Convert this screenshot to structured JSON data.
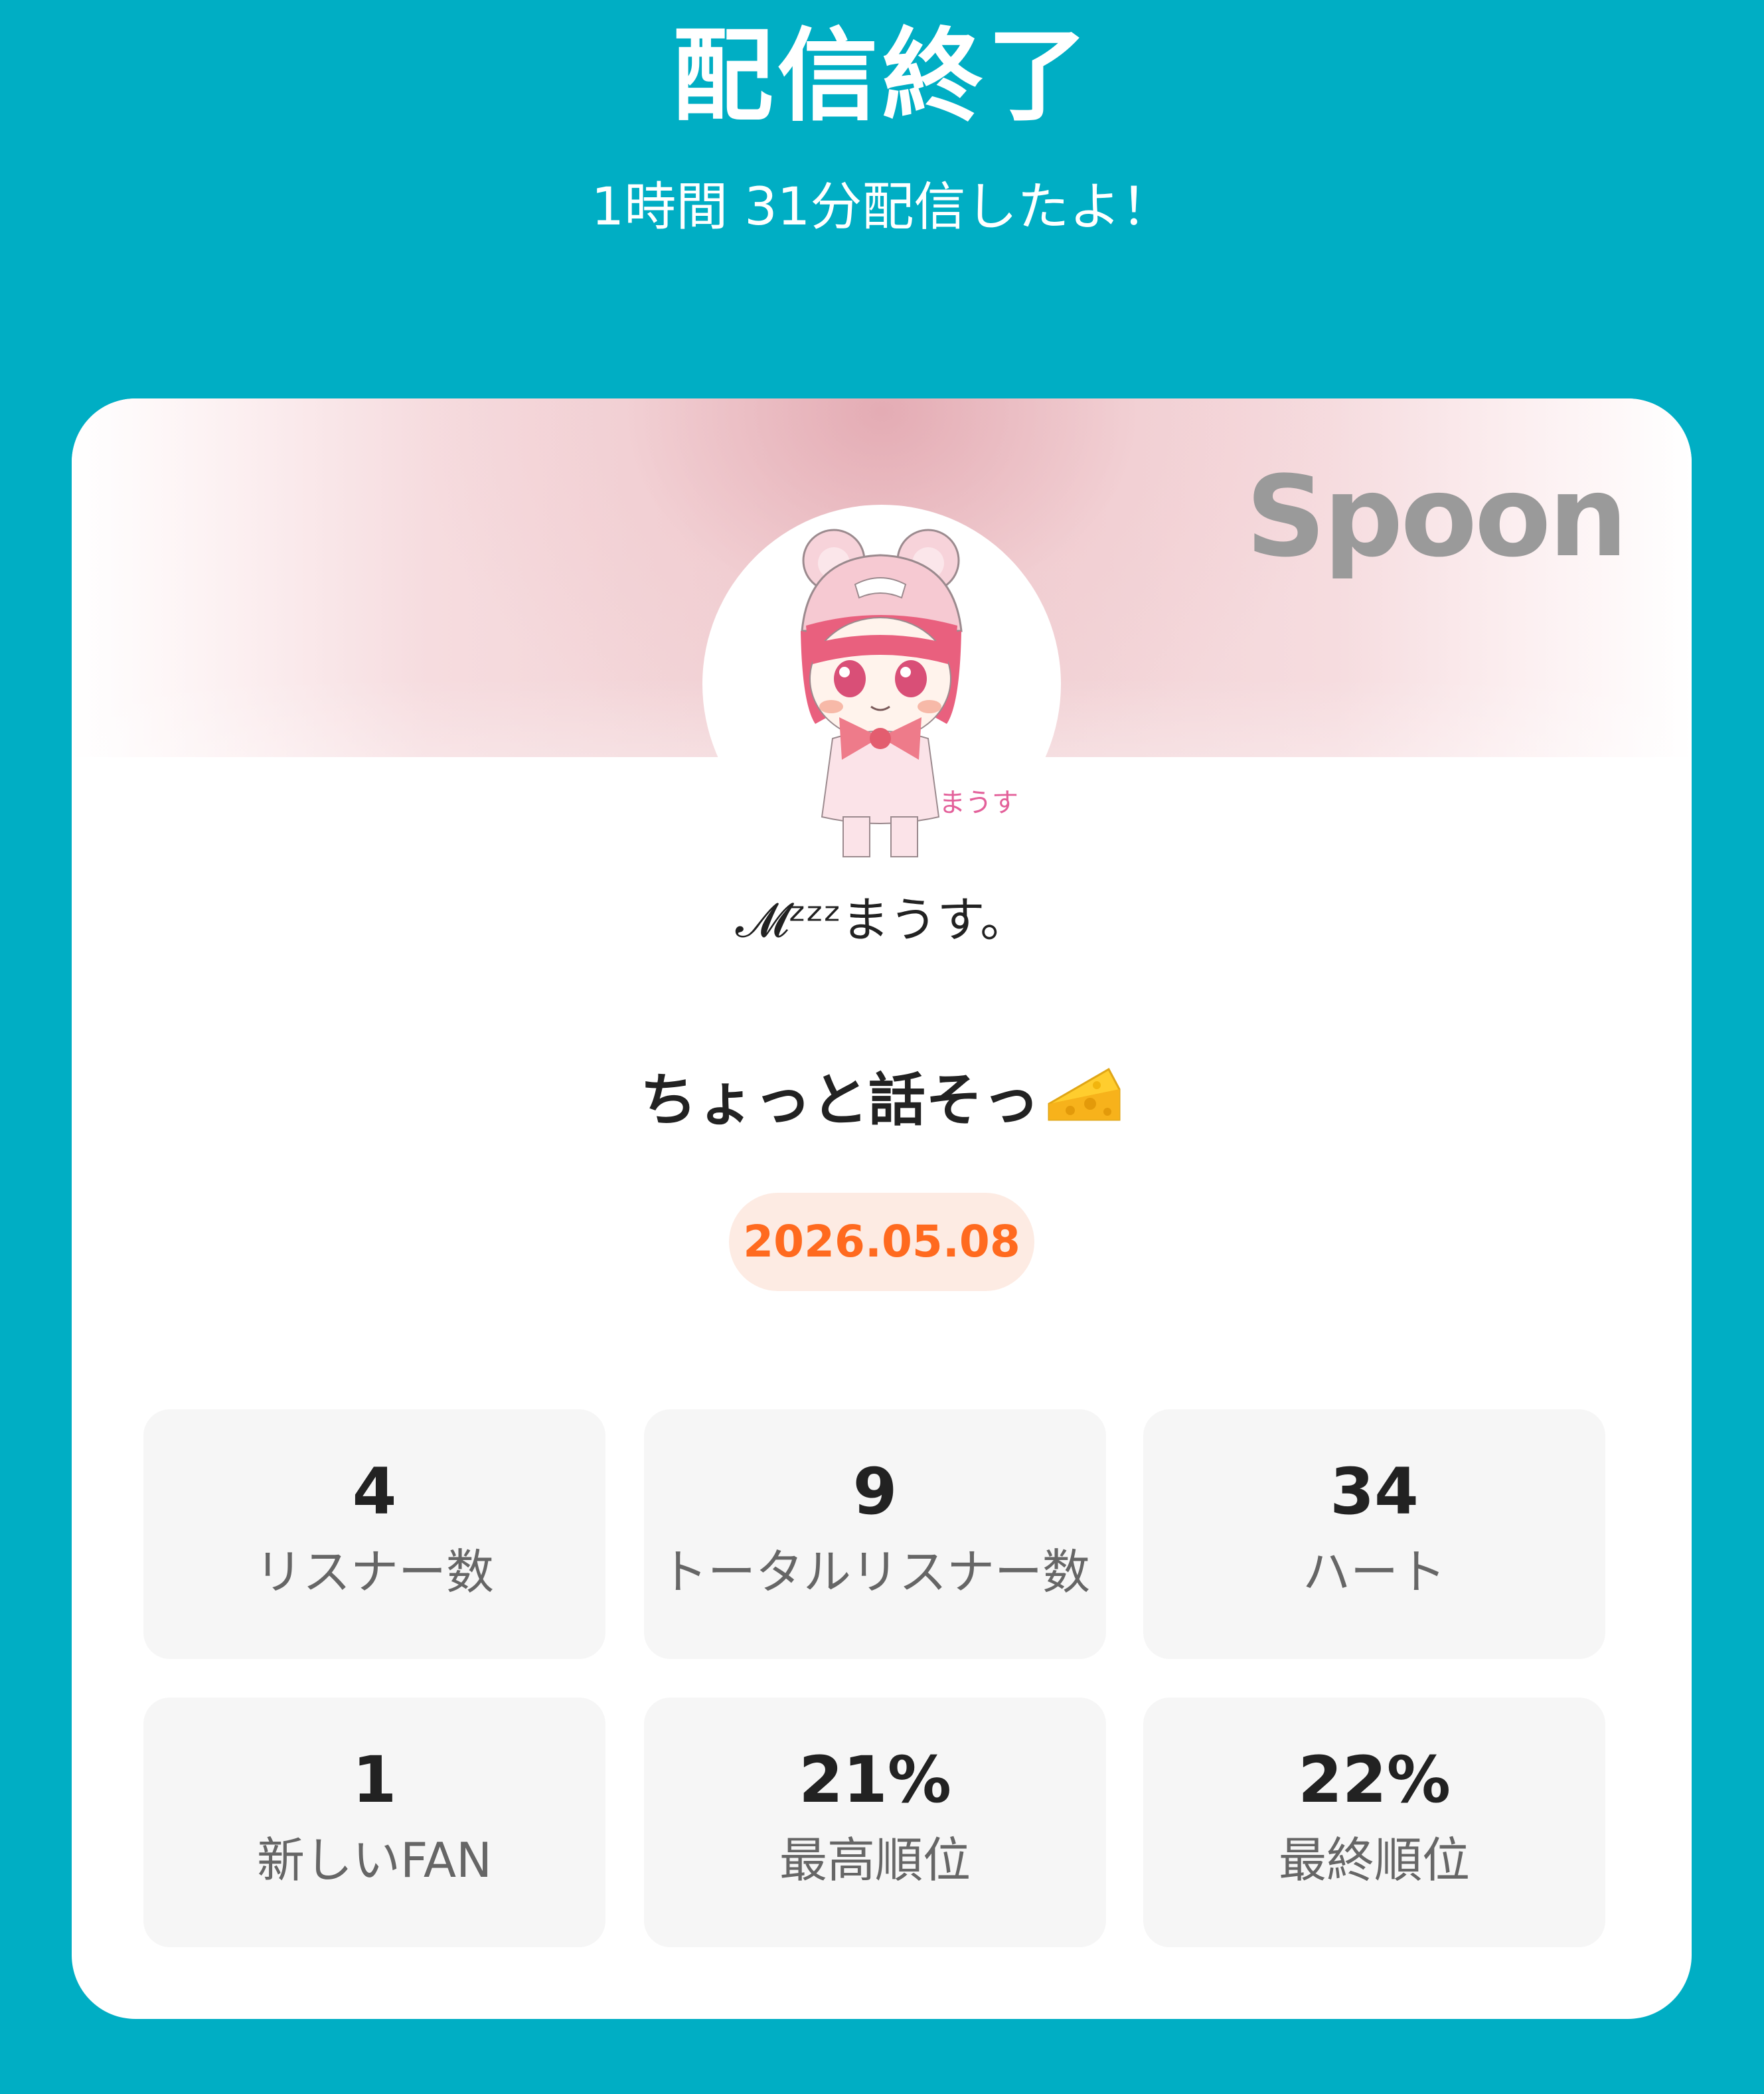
{
  "header": {
    "title": "配信終了",
    "subtitle": "1時間 31分配信したよ！"
  },
  "card": {
    "brand": "Spoon",
    "username": "𝓜ᶻᶻᶻまうす。",
    "live_title": "ちょっと話そっ",
    "title_icon": "cheese-icon",
    "date": "2026.05.08",
    "date_color": "#ff6a1f",
    "avatar_signature": "まうす"
  },
  "stats": [
    {
      "value": "4",
      "label": "リスナー数"
    },
    {
      "value": "9",
      "label": "トータルリスナー数"
    },
    {
      "value": "34",
      "label": "ハート"
    },
    {
      "value": "1",
      "label": "新しいFAN"
    },
    {
      "value": "21%",
      "label": "最高順位"
    },
    {
      "value": "22%",
      "label": "最終順位"
    }
  ],
  "colors": {
    "background": "#00aec4",
    "card": "#ffffff",
    "stat_box": "#f6f6f6",
    "badge_bg": "#fdebe3"
  }
}
